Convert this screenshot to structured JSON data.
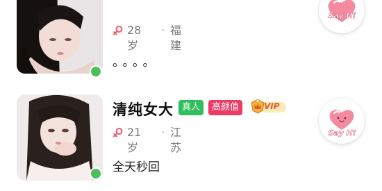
{
  "users": [
    {
      "name": "",
      "age": "28岁",
      "separator": "·",
      "location": "福建",
      "bio": "。。。。",
      "online": true,
      "say_hi": "Say Hi"
    },
    {
      "name": "清纯女大",
      "badges": {
        "real": "真人",
        "pretty": "高颜值",
        "vip": "VIP"
      },
      "age": "21岁",
      "separator": "·",
      "location": "江苏",
      "bio": "全天秒回",
      "online": true,
      "say_hi": "Say Hi"
    }
  ],
  "colors": {
    "accent_purple": "#8a6cf0",
    "badge_real": "#2fbf5b",
    "badge_pretty": "#ec3b64",
    "online": "#4cc05a",
    "gender_female": "#f05b6f",
    "heart_pink": "#f48aa0"
  },
  "icons": {
    "gender": "female-icon",
    "vip": "vip-crown-icon",
    "say_hi": "heart-icon"
  }
}
